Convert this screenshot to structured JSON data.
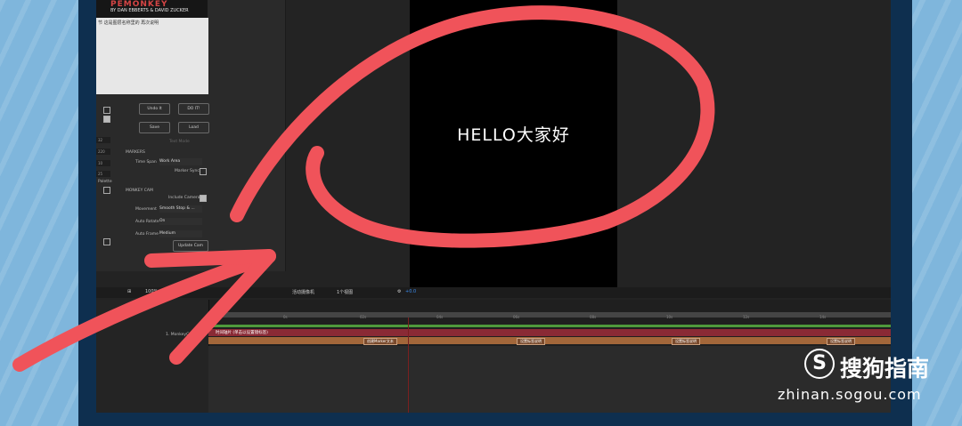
{
  "plugin": {
    "logo_title": "PEMONKEY",
    "logo_byline": "BY DAN EBBERTS & DAVID ZUCKER",
    "notes_text": "节 这是图层名称里的 再次说明",
    "undo_label": "Undo It",
    "doit_label": "DO IT!",
    "save_label": "Save",
    "load_label": "Load",
    "markers_heading": "MARKERS",
    "time_span_label": "Time Span",
    "time_span_value": "Work Area",
    "marker_sync_label": "Marker Sync",
    "monkeycam_heading": "MONKEY CAM",
    "include_camera_label": "Include Camera",
    "movement_label": "Movement",
    "movement_value": "Smooth Stop & ...",
    "auto_rotate_label": "Auto Rotate",
    "auto_rotate_value": "On",
    "auto_frame_label": "Auto Frame",
    "auto_frame_value": "Medium",
    "update_cam_label": "Update Cam",
    "text_mode_label": "Text Mode",
    "side_fields": [
      "32",
      "220",
      "10",
      "25"
    ],
    "palette_label": "Palette"
  },
  "composition": {
    "text": "HELLO大家好"
  },
  "viewer_bar": {
    "zoom": "100%",
    "camera_label": "活动摄像机",
    "views_label": "1个视图",
    "value": "+0.0"
  },
  "timeline": {
    "layer_name": "1. MonkeyC",
    "track_label": "时间轴片 (单击以设置镜标签)",
    "chips": [
      "创建Marker文本",
      "设置标签说明",
      "设置标签说明",
      "设置标签说明"
    ],
    "ticks": [
      "0s",
      "02s",
      "04s",
      "06s",
      "08s",
      "10s",
      "12s",
      "14s"
    ]
  },
  "watermark": {
    "icon_glyph": "S",
    "title": "搜狗指南",
    "url": "zhinan.sogou.com"
  },
  "colors": {
    "annotation": "#f0535a",
    "background": "#7fb6dc",
    "frame": "#0e2f4f"
  }
}
